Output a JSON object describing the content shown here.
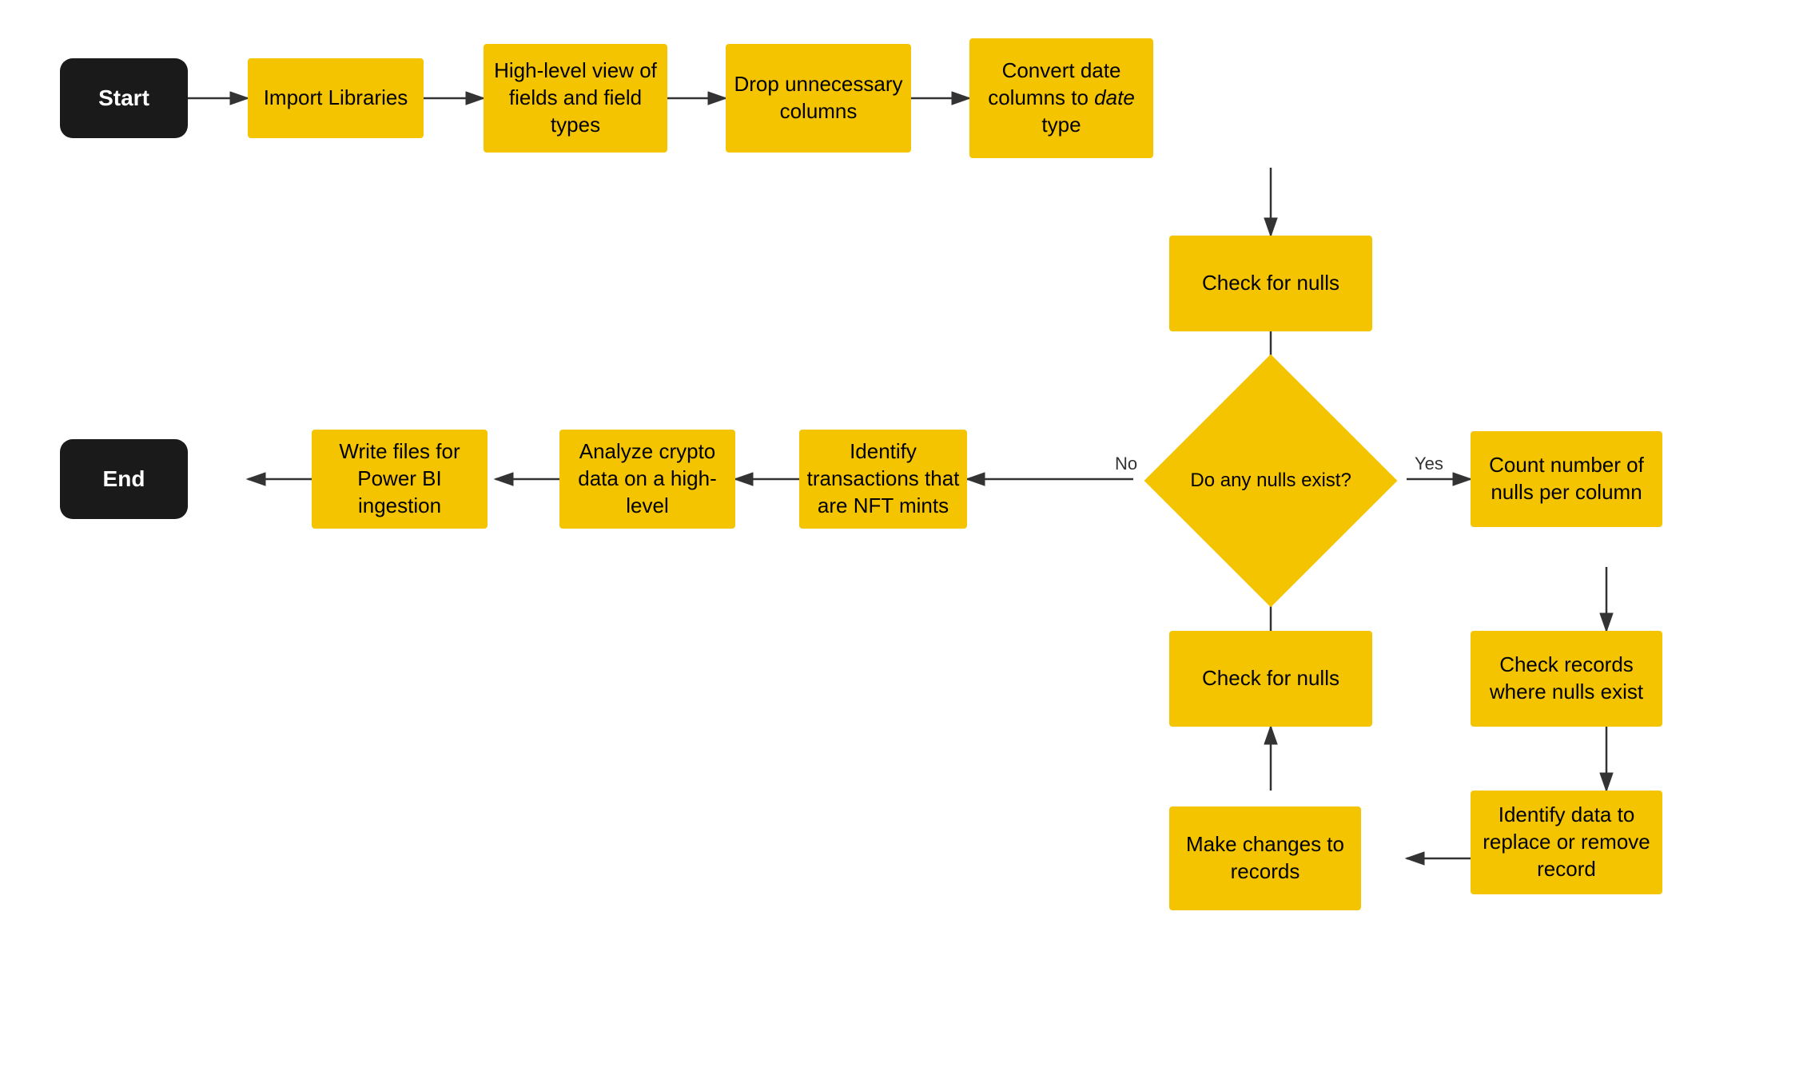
{
  "nodes": {
    "start": {
      "label": "Start"
    },
    "end": {
      "label": "End"
    },
    "import_libraries": {
      "label": "Import Libraries"
    },
    "high_level_view": {
      "label": "High-level view of fields and field types"
    },
    "drop_columns": {
      "label": "Drop unnecessary columns"
    },
    "convert_date": {
      "label": "Convert date columns to date type"
    },
    "check_nulls_1": {
      "label": "Check for nulls"
    },
    "do_any_nulls": {
      "label": "Do any nulls exist?"
    },
    "count_nulls": {
      "label": "Count number of nulls per column"
    },
    "check_records": {
      "label": "Check records where nulls exist"
    },
    "identify_data": {
      "label": "Identify data to replace or remove record"
    },
    "make_changes": {
      "label": "Make changes to records"
    },
    "check_nulls_2": {
      "label": "Check for nulls"
    },
    "identify_nft": {
      "label": "Identify transactions that are NFT mints"
    },
    "analyze_crypto": {
      "label": "Analyze crypto data on a high-level"
    },
    "write_files": {
      "label": "Write files for Power BI ingestion"
    }
  },
  "labels": {
    "yes": "Yes",
    "no": "No"
  }
}
